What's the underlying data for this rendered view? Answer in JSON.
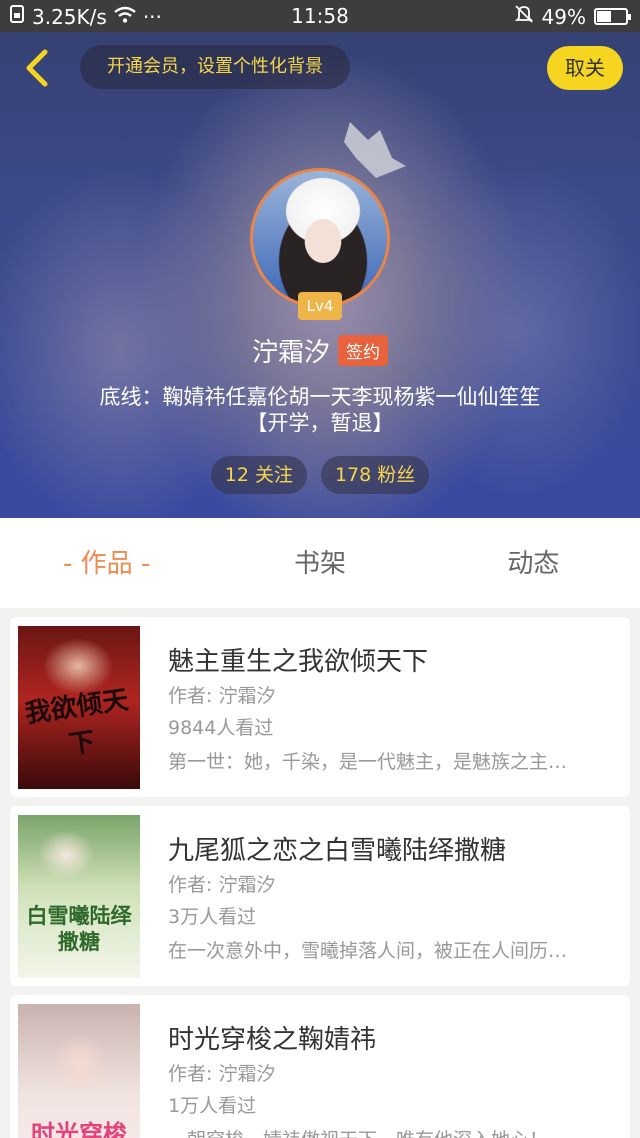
{
  "status_bar": {
    "speed": "3.25K/s",
    "dots": "···",
    "time": "11:58",
    "battery": "49%",
    "battery_level": 0.49
  },
  "header": {
    "vip_banner": "开通会员，设置个性化背景",
    "unfollow_label": "取关"
  },
  "profile": {
    "level": "Lv4",
    "username": "泞霜汐",
    "signed_badge": "签约",
    "bio_line1": "底线：鞠婧祎任嘉伦胡一天李现杨紫一仙仙笙笙",
    "bio_line2": "【开学，暂退】",
    "following": "12 关注",
    "followers": "178 粉丝"
  },
  "tabs": [
    {
      "label": "- 作品 -",
      "active": true
    },
    {
      "label": "书架",
      "active": false
    },
    {
      "label": "动态",
      "active": false
    }
  ],
  "books": [
    {
      "title": "魅主重生之我欲倾天下",
      "author": "作者: 泞霜汐",
      "views": "9844人看过",
      "desc": "第一世：她，千染，是一代魅主，是魅族之主…",
      "cover_text": "我欲倾天下"
    },
    {
      "title": "九尾狐之恋之白雪曦陆绎撒糖",
      "author": "作者: 泞霜汐",
      "views": "3万人看过",
      "desc": "在一次意外中，雪曦掉落人间，被正在人间历…",
      "cover_text": "白雪曦陆绎撒糖"
    },
    {
      "title": "时光穿梭之鞠婧祎",
      "author": "作者: 泞霜汐",
      "views": "1万人看过",
      "desc": "一朝穿梭，婧祎傲视天下，唯有他深入她心！…",
      "cover_text": "时光穿梭"
    }
  ],
  "colors": {
    "accent_orange": "#f08a4e",
    "badge_yellow": "#f5d51f",
    "link_yellow": "#f7d64a"
  }
}
